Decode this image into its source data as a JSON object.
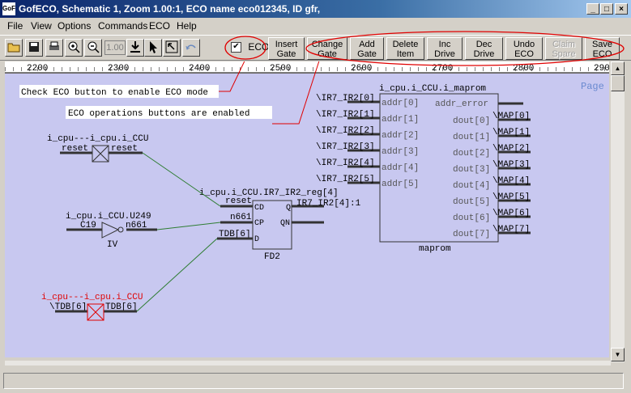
{
  "window": {
    "icon_label": "GoF",
    "title": "GofECO, Schematic 1, Zoom 1.00:1, ECO name eco012345, ID gfr,"
  },
  "window_controls": {
    "minimize": "_",
    "maximize": "□",
    "close": "×"
  },
  "menu": [
    "File",
    "View",
    "Options",
    "Commands",
    "ECO",
    "Help"
  ],
  "toolbar": {
    "icons": [
      "open-folder-icon",
      "save-icon",
      "print-icon",
      "zoom-in-icon",
      "zoom-out-icon",
      "zoom-level-field",
      "download-icon",
      "select-pointer-icon",
      "zoom-fit-icon",
      "undo-curve-icon"
    ],
    "zoom_value": "1.00",
    "eco_checkbox": {
      "label": "ECO",
      "checked": true,
      "mark": "✔"
    },
    "buttons": [
      {
        "line1": "Insert",
        "line2": "Gate",
        "enabled": true
      },
      {
        "line1": "Change",
        "line2": "Gate",
        "enabled": true
      },
      {
        "line1": "Add",
        "line2": "Gate",
        "enabled": true
      },
      {
        "line1": "Delete",
        "line2": "Item",
        "enabled": true
      },
      {
        "line1": "Inc",
        "line2": "Drive",
        "enabled": true
      },
      {
        "line1": "Dec",
        "line2": "Drive",
        "enabled": true
      },
      {
        "line1": "Undo",
        "line2": "ECO",
        "enabled": true
      },
      {
        "line1": "Claim",
        "line2": "Spare",
        "enabled": false
      },
      {
        "line1": "Save",
        "line2": "ECO",
        "enabled": true
      }
    ]
  },
  "ruler": {
    "labels": [
      "2200",
      "2300",
      "2400",
      "2500",
      "2600",
      "2700",
      "2800",
      "290"
    ]
  },
  "annotations": {
    "check_eco": "Check ECO button to enable ECO mode",
    "eco_ops": "ECO operations buttons are enabled"
  },
  "schematic": {
    "page_label": "Page",
    "cell_reset": {
      "title": "i_cpu---i_cpu.i_CCU",
      "pin_left": "reset",
      "pin_right": "reset"
    },
    "cell_tdb": {
      "title": "i_cpu---i_cpu.i_CCU",
      "pin_left": "\\TDB[6]",
      "pin_right": "TDB[6]"
    },
    "inverter": {
      "title": "i_cpu.i_CCU.U249",
      "in_net": "C19",
      "out_net": "n661",
      "type": "IV"
    },
    "flop": {
      "title": "i_cpu.i_CCU.IR7_IR2_reg[4]",
      "pins": [
        "CD",
        "CP",
        "D",
        "Q",
        "QN"
      ],
      "nets": [
        "reset",
        "n661",
        "TDB[6]"
      ],
      "type": "FD2",
      "q_net": "IR7_IR2[4]:1"
    },
    "maprom": {
      "title": "i_cpu.i_CCU.i_maprom",
      "type": "maprom",
      "in_nets": [
        "\\IR7_IR2[0]",
        "\\IR7_IR2[1]",
        "\\IR7_IR2[2]",
        "\\IR7_IR2[3]",
        "\\IR7_IR2[4]",
        "\\IR7_IR2[5]"
      ],
      "in_pins": [
        "addr[0]",
        "addr[1]",
        "addr[2]",
        "addr[3]",
        "addr[4]",
        "addr[5]"
      ],
      "err_pin": "addr_error",
      "out_pins": [
        "dout[0]",
        "dout[1]",
        "dout[2]",
        "dout[3]",
        "dout[4]",
        "dout[5]",
        "dout[6]",
        "dout[7]"
      ],
      "out_nets": [
        "\\MAP[0]",
        "\\MAP[1]",
        "\\MAP[2]",
        "\\MAP[3]",
        "\\MAP[4]",
        "\\MAP[5]",
        "\\MAP[6]",
        "\\MAP[7]"
      ]
    }
  },
  "colors": {
    "canvas": "#c8c8f0",
    "highlight": "#e00000",
    "wire": "#2e7d32",
    "pin": "#333333",
    "annotation_box": "#ffffff"
  }
}
